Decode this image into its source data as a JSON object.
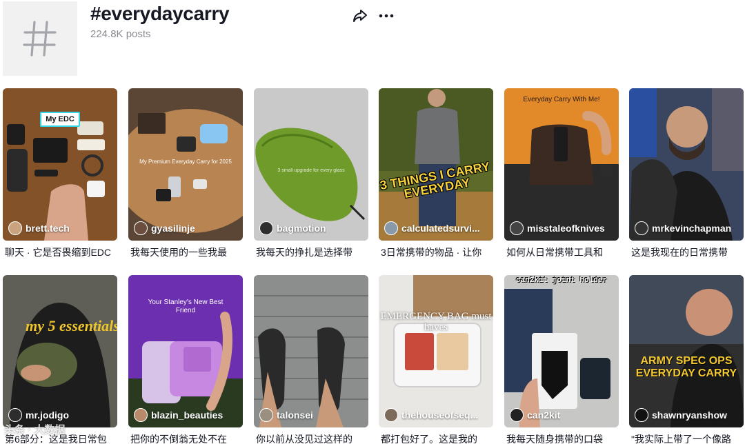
{
  "header": {
    "tag": "#everydaycarry",
    "post_count": "224.8K posts",
    "icons": {
      "tile": "hashtag-icon",
      "share": "share-icon",
      "more": "more-icon"
    }
  },
  "videos": [
    {
      "username": "brett.tech",
      "caption": "聊天 · 它是否畏缩到EDC",
      "overlay": "My EDC",
      "avatar_color": "#c9a27e"
    },
    {
      "username": "gyasilinje",
      "caption": "我每天使用的一些我最",
      "overlay": "My Premium Everyday Carry for 2025",
      "avatar_color": "#6b4e3d"
    },
    {
      "username": "bagmotion",
      "caption": "我每天的挣扎是选择带",
      "overlay": "3 small upgrade for every glass",
      "avatar_color": "#2f2f2f"
    },
    {
      "username": "calculatedsurvi...",
      "caption": "3日常携带的物品 · 让你",
      "overlay": "3 THINGS I CARRY EVERYDAY",
      "avatar_color": "#8899aa"
    },
    {
      "username": "misstaleofknives",
      "caption": "如何从日常携带工具和",
      "overlay": "Everyday Carry With Me!",
      "avatar_color": "#444444"
    },
    {
      "username": "mrkevinchapman",
      "caption": "这是我现在的日常携带",
      "overlay": "",
      "avatar_color": "#333333"
    },
    {
      "username": "mr.jodigo",
      "caption": "第6部分：这是我日常包",
      "overlay": "my 5 essentials",
      "avatar_color": "#2d2d2d"
    },
    {
      "username": "blazin_beauties",
      "caption": "把你的不倒翁无处不在",
      "overlay": "Your Stanley's New Best Friend",
      "avatar_color": "#b98a6a"
    },
    {
      "username": "talonsei",
      "caption": "你以前从没见过这样的",
      "overlay": "",
      "avatar_color": "#9b8f80"
    },
    {
      "username": "thehouseofseq...",
      "caption": "都打包好了。这是我的",
      "overlay": "EMERGENCY BAG must haves",
      "avatar_color": "#7c6a5a"
    },
    {
      "username": "can2kit",
      "caption": "我每天随身携带的口袋",
      "overlay": "can2kit joint holder",
      "avatar_color": "#222222"
    },
    {
      "username": "shawnryanshow",
      "caption": "\"我实际上带了一个像路",
      "overlay": "ARMY SPEC OPS EVERYDAY CARRY",
      "avatar_color": "#111111"
    }
  ],
  "watermark": "头条 · 大数据"
}
